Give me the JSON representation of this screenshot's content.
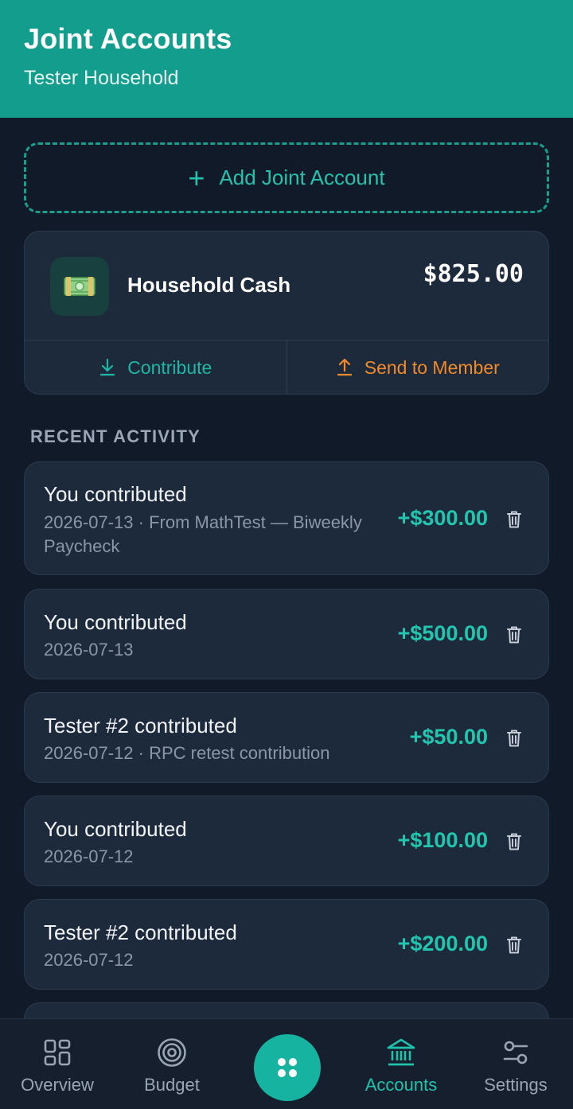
{
  "header": {
    "title": "Joint Accounts",
    "subtitle": "Tester Household"
  },
  "add_button": {
    "label": "Add Joint Account",
    "icon": "plus-icon"
  },
  "account": {
    "name": "Household Cash",
    "balance": "$825.00",
    "icon": "cash-icon",
    "contribute_label": "Contribute",
    "send_label": "Send to Member"
  },
  "recent": {
    "label": "RECENT ACTIVITY",
    "items": [
      {
        "who": "You contributed",
        "meta": "2026-07-13 · From MathTest — Biweekly Paycheck",
        "amount": "+$300.00"
      },
      {
        "who": "You contributed",
        "meta": "2026-07-13",
        "amount": "+$500.00"
      },
      {
        "who": "Tester #2 contributed",
        "meta": "2026-07-12 · RPC retest contribution",
        "amount": "+$50.00"
      },
      {
        "who": "You contributed",
        "meta": "2026-07-12",
        "amount": "+$100.00"
      },
      {
        "who": "Tester #2 contributed",
        "meta": "2026-07-12",
        "amount": "+$200.00"
      }
    ]
  },
  "nav": {
    "overview": "Overview",
    "budget": "Budget",
    "accounts": "Accounts",
    "settings": "Settings",
    "active": "accounts"
  },
  "colors": {
    "header": "#139d8c",
    "accent": "#22c5ae",
    "send": "#f08a2a",
    "background": "#111a28",
    "card": "#1d2a3b"
  }
}
